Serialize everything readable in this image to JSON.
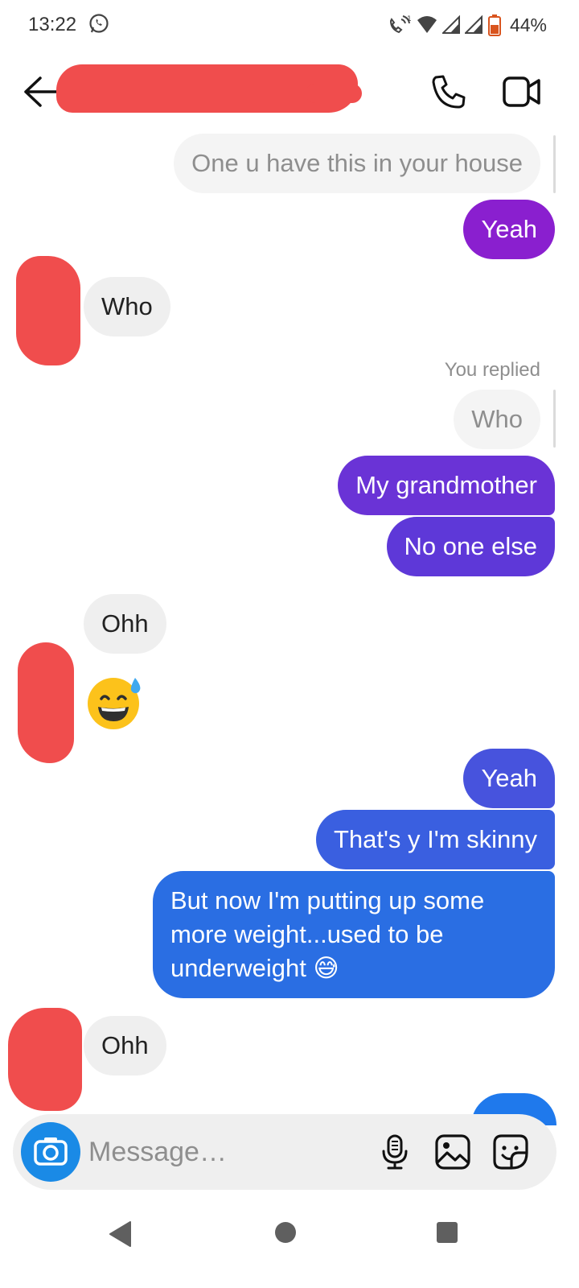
{
  "status_bar": {
    "time": "13:22",
    "battery_percent": "44%",
    "icons": [
      "whatsapp-icon",
      "wifi-calling-icon",
      "wifi-icon",
      "signal-icon",
      "signal-icon",
      "battery-low-icon"
    ]
  },
  "header": {
    "contact_name_redacted": true,
    "icons": [
      "back-arrow-icon",
      "phone-icon",
      "video-camera-icon"
    ]
  },
  "messages": [
    {
      "side": "reply-quote",
      "text": "One u have this in your house"
    },
    {
      "side": "out",
      "text": "Yeah"
    },
    {
      "side": "in",
      "text": "Who"
    },
    {
      "side": "label",
      "text": "You replied"
    },
    {
      "side": "reply-quote",
      "text": "Who"
    },
    {
      "side": "out",
      "text": "My grandmother"
    },
    {
      "side": "out",
      "text": "No one else"
    },
    {
      "side": "in",
      "text": "Ohh"
    },
    {
      "side": "in-emoji",
      "text": "😅"
    },
    {
      "side": "out",
      "text": "Yeah"
    },
    {
      "side": "out",
      "text": "That's y I'm skinny"
    },
    {
      "side": "out",
      "lines": [
        "But now I'm putting up some",
        "more weight...used to be",
        "underweight 😅"
      ]
    },
    {
      "side": "in",
      "text": "Ohh"
    }
  ],
  "composer": {
    "placeholder": "Message…",
    "icons": [
      "camera-icon",
      "microphone-icon",
      "gallery-icon",
      "sticker-icon"
    ]
  },
  "colors": {
    "out_purple": "#8a1fcf",
    "out_violet": "#6a33d6",
    "out_indigo": "#4b4ddf",
    "out_blue": "#2a6ee3",
    "out_bright_blue": "#1f79ec",
    "incoming_bg": "#efefef",
    "redaction": "#f04d4d",
    "camera_button": "#1a8ae6"
  },
  "nav": {
    "icons": [
      "back-triangle-icon",
      "home-circle-icon",
      "recents-square-icon"
    ]
  }
}
